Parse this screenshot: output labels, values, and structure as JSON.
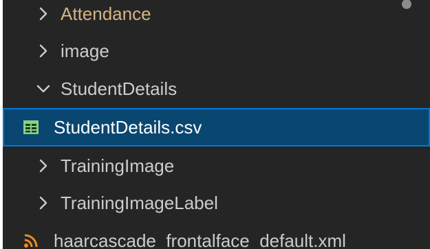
{
  "explorer": {
    "items": [
      {
        "label": "Attendance",
        "type": "folder",
        "expanded": false,
        "modified": true
      },
      {
        "label": "image",
        "type": "folder",
        "expanded": false
      },
      {
        "label": "StudentDetails",
        "type": "folder",
        "expanded": true
      },
      {
        "label": "StudentDetails.csv",
        "type": "file",
        "icon": "csv-table-icon",
        "selected": true
      },
      {
        "label": "TrainingImage",
        "type": "folder",
        "expanded": false
      },
      {
        "label": "TrainingImageLabel",
        "type": "folder",
        "expanded": false
      },
      {
        "label": "haarcascade_frontalface_default.xml",
        "type": "file",
        "icon": "rss-feed-icon"
      }
    ]
  },
  "colors": {
    "background": "#252526",
    "selection": "#094771",
    "selection_border": "#0078d4",
    "modified_text": "#d4b483",
    "csv_icon": "#89d185",
    "xml_icon": "#f08a24"
  }
}
